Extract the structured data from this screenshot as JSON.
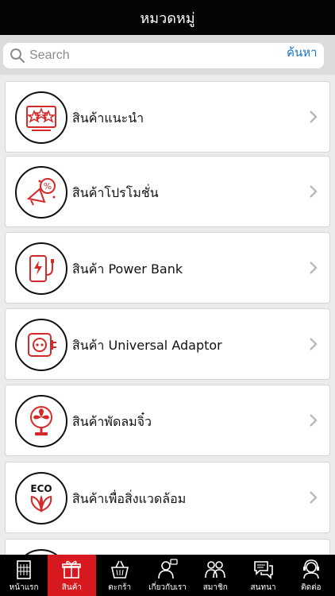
{
  "header": {
    "title": "หมวดหมู่"
  },
  "search": {
    "placeholder": "Search",
    "button_label": "ค้นหา"
  },
  "categories": [
    {
      "label": "สินค้าแนะนำ",
      "icon": "recommended-stars-icon"
    },
    {
      "label": "สินค้าโปรโมชั่น",
      "icon": "promotion-megaphone-icon"
    },
    {
      "label": "สินค้า Power Bank",
      "icon": "power-bank-icon"
    },
    {
      "label": "สินค้า Universal Adaptor",
      "icon": "universal-adaptor-icon"
    },
    {
      "label": "สินค้าพัดลมจิ๋ว",
      "icon": "mini-fan-icon"
    },
    {
      "label": "สินค้าเพื่อสิ่งแวดล้อม",
      "icon": "eco-leaf-icon",
      "icon_text": "ECO"
    }
  ],
  "tabs": [
    {
      "label": "หน้าแรก",
      "icon": "home-building-icon",
      "active": false
    },
    {
      "label": "สินค้า",
      "icon": "gift-box-icon",
      "active": true
    },
    {
      "label": "ตะกร้า",
      "icon": "basket-icon",
      "active": false
    },
    {
      "label": "เกี่ยวกับเรา",
      "icon": "about-us-icon",
      "active": false
    },
    {
      "label": "สมาชิก",
      "icon": "members-icon",
      "active": false
    },
    {
      "label": "สนทนา",
      "icon": "chat-icon",
      "active": false
    },
    {
      "label": "ติดต่อ",
      "icon": "contact-support-icon",
      "active": false
    }
  ],
  "colors": {
    "accent": "#d8181f",
    "header_bg": "#050505",
    "link": "#1a73c9",
    "icon_red": "#d42a2a"
  }
}
